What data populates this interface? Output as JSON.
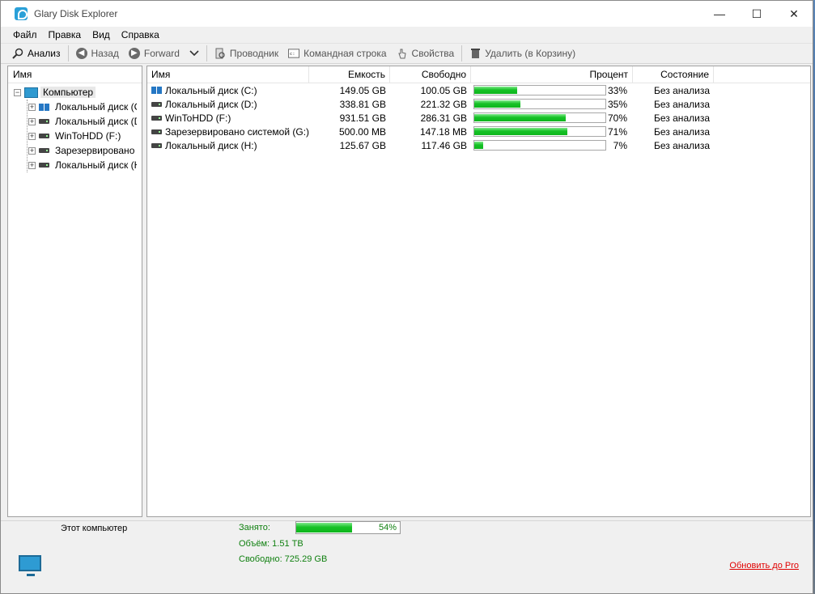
{
  "window": {
    "title": "Glary Disk Explorer",
    "controls": {
      "minimize": "—",
      "maximize": "☐",
      "close": "✕"
    }
  },
  "menu": [
    "Файл",
    "Правка",
    "Вид",
    "Справка"
  ],
  "toolbar": {
    "analyze": "Анализ",
    "back": "Назад",
    "forward": "Forward",
    "explorer": "Проводник",
    "cmd": "Командная строка",
    "properties": "Свойства",
    "delete": "Удалить (в Корзину)"
  },
  "tree": {
    "header": "Имя",
    "root": "Компьютер",
    "items": [
      {
        "label": "Локальный диск (C:)",
        "icon": "windows-drive-icon"
      },
      {
        "label": "Локальный диск (D:)",
        "icon": "drive-icon"
      },
      {
        "label": "WinToHDD (F:)",
        "icon": "drive-icon"
      },
      {
        "label": "Зарезервировано системой (G:)",
        "icon": "drive-icon"
      },
      {
        "label": "Локальный диск (H:)",
        "icon": "drive-icon"
      }
    ]
  },
  "table": {
    "headers": {
      "name": "Имя",
      "capacity": "Емкость",
      "free": "Свободно",
      "percent": "Процент",
      "state": "Состояние"
    },
    "rows": [
      {
        "name": "Локальный диск (C:)",
        "icon": "windows-drive-icon",
        "capacity": "149.05 GB",
        "free": "100.05 GB",
        "percent": 33,
        "percent_label": "33%",
        "state": "Без анализа"
      },
      {
        "name": "Локальный диск (D:)",
        "icon": "drive-icon",
        "capacity": "338.81 GB",
        "free": "221.32 GB",
        "percent": 35,
        "percent_label": "35%",
        "state": "Без анализа"
      },
      {
        "name": "WinToHDD (F:)",
        "icon": "drive-icon",
        "capacity": "931.51 GB",
        "free": "286.31 GB",
        "percent": 70,
        "percent_label": "70%",
        "state": "Без анализа"
      },
      {
        "name": "Зарезервировано системой (G:)",
        "icon": "drive-icon",
        "capacity": "500.00 MB",
        "free": "147.18 MB",
        "percent": 71,
        "percent_label": "71%",
        "state": "Без анализа"
      },
      {
        "name": "Локальный диск (H:)",
        "icon": "drive-icon",
        "capacity": "125.67 GB",
        "free": "117.46 GB",
        "percent": 7,
        "percent_label": "7%",
        "state": "Без анализа"
      }
    ]
  },
  "status": {
    "computer_label": "Этот компьютер",
    "used_label": "Занято:",
    "used_percent": 54,
    "used_percent_label": "54%",
    "volume": "Объём: 1.51 TB",
    "free": "Свободно: 725.29 GB",
    "upgrade": "Обновить до Pro"
  },
  "colors": {
    "bar_green": "#16c226",
    "status_green": "#108010",
    "link_red": "#e00000",
    "computer_blue": "#2f9ad1"
  }
}
